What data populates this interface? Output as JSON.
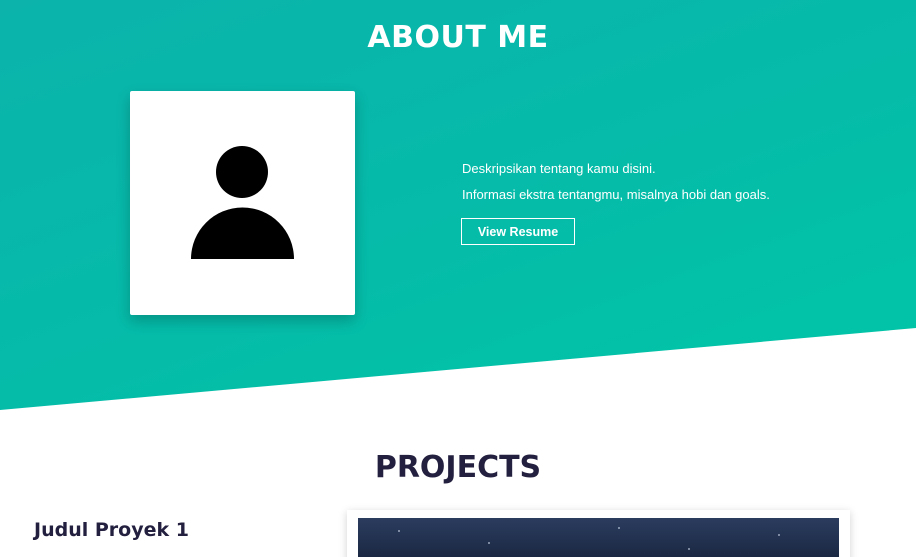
{
  "about": {
    "title": "ABOUT ME",
    "avatar_icon": "person-icon",
    "description_line1": "Deskripsikan tentang kamu disini.",
    "description_line2": "Informasi ekstra tentangmu, misalnya hobi dan goals.",
    "resume_button_label": "View Resume",
    "gradient_colors": [
      "#0bb3ab",
      "#00c6a6"
    ]
  },
  "projects": {
    "title": "PROJECTS",
    "items": [
      {
        "name": "Judul Proyek 1"
      }
    ]
  },
  "colors": {
    "accent": "#05bca9",
    "heading_dark": "#23203f",
    "text_light": "#ffffff"
  }
}
